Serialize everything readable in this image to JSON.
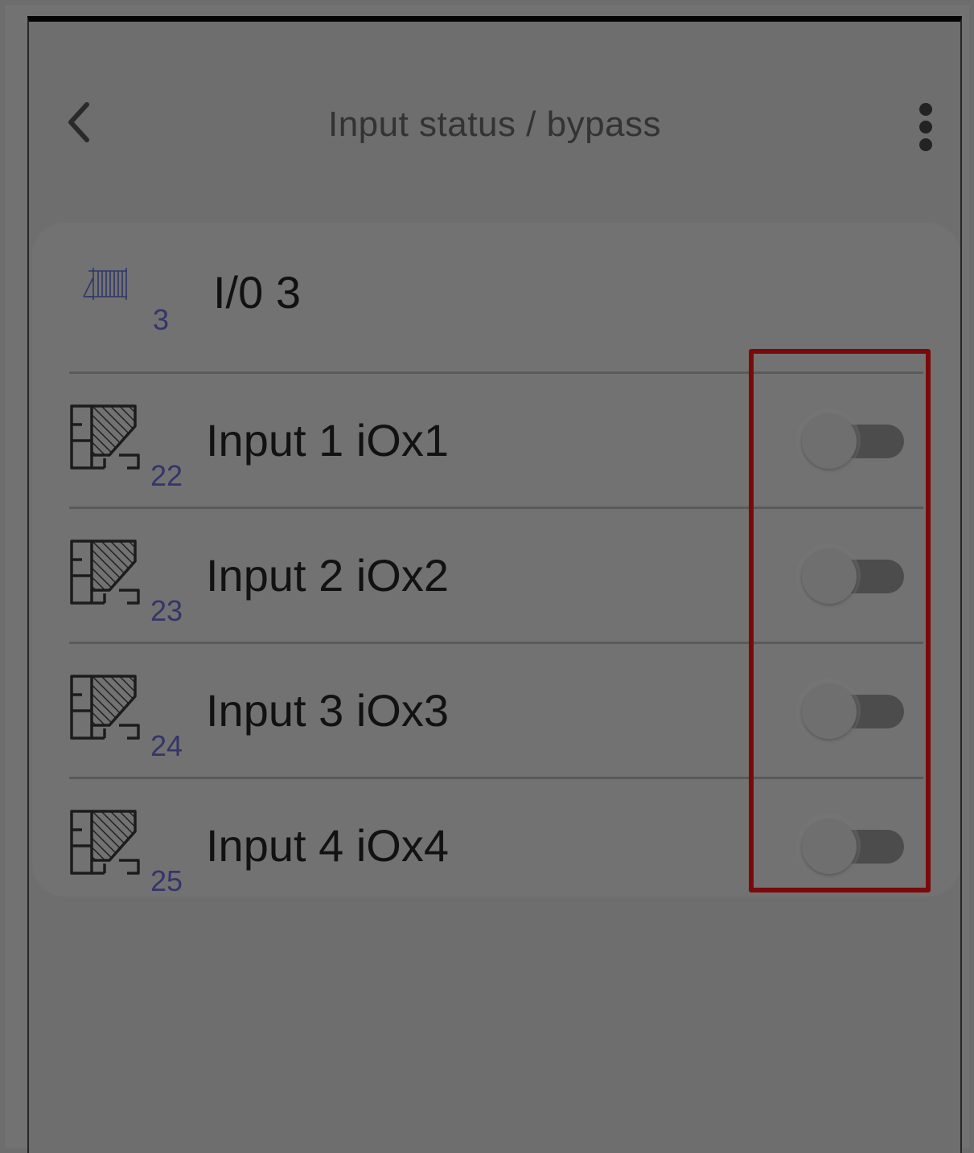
{
  "header": {
    "title": "Input status / bypass",
    "back_icon": "chevron-left-icon",
    "menu_icon": "kebab-menu-icon"
  },
  "device": {
    "icon": "gate-icon",
    "number": "3",
    "name": "I/0 3"
  },
  "inputs": [
    {
      "icon": "floorplan-zone-icon",
      "number": "22",
      "label": "Input 1 iOx1",
      "bypass": false
    },
    {
      "icon": "floorplan-zone-icon",
      "number": "23",
      "label": "Input 2 iOx2",
      "bypass": false
    },
    {
      "icon": "floorplan-zone-icon",
      "number": "24",
      "label": "Input 3 iOx3",
      "bypass": false
    },
    {
      "icon": "floorplan-zone-icon",
      "number": "25",
      "label": "Input 4 iOx4",
      "bypass": false
    }
  ],
  "colors": {
    "overlay": "#6e6e6e",
    "highlight": "#7a0a0a",
    "zone_number": "#353569"
  }
}
